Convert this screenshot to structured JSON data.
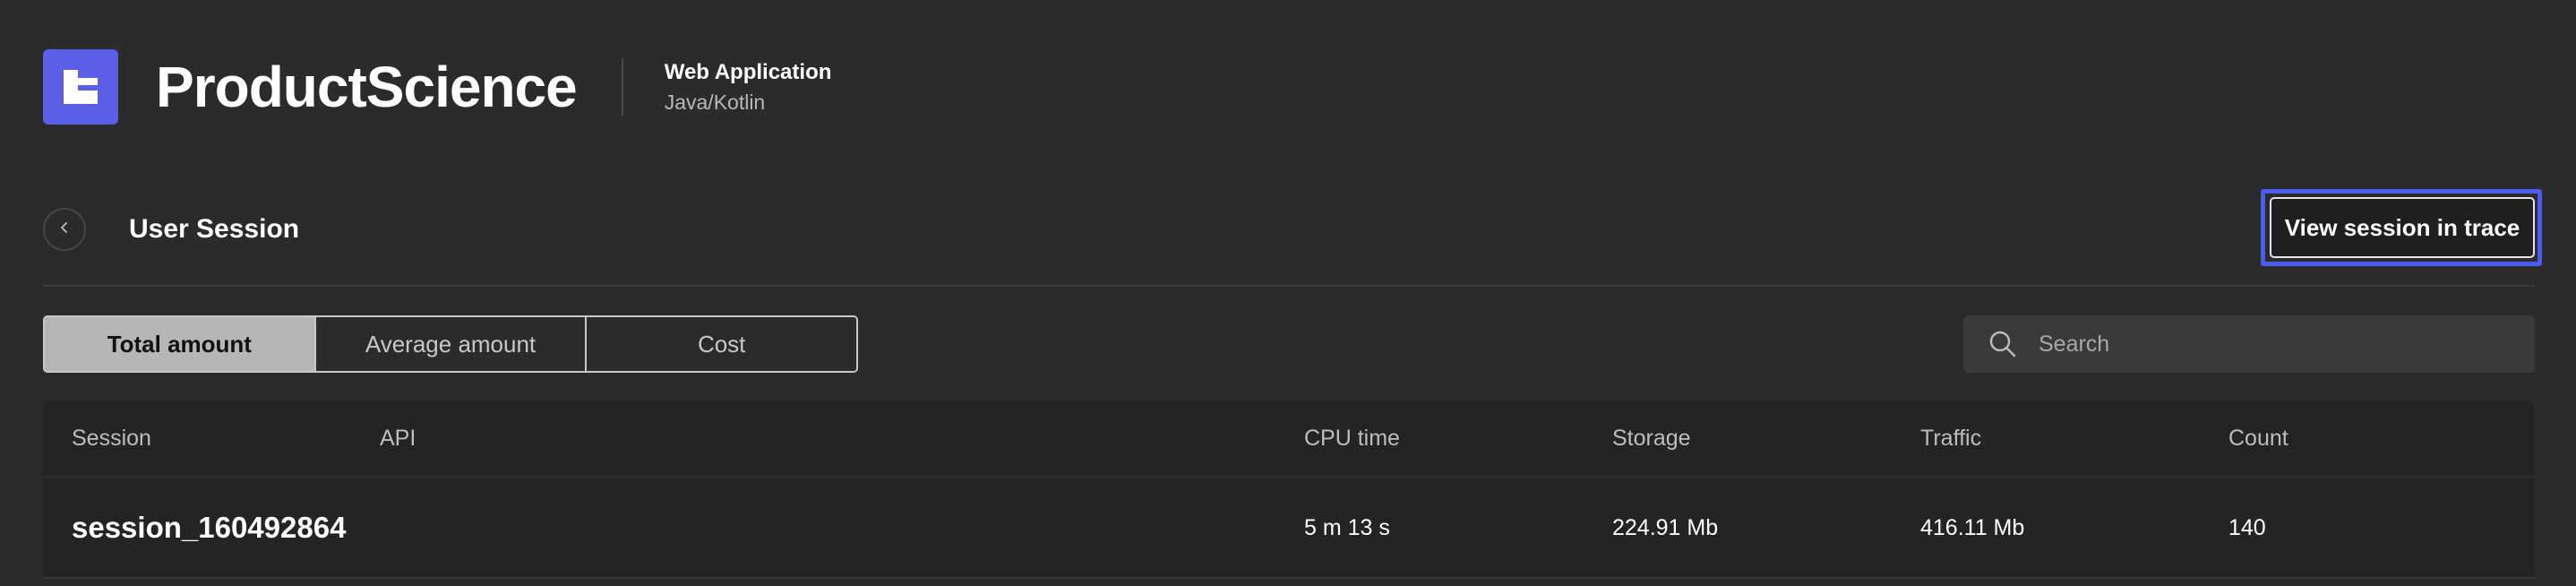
{
  "brand": {
    "name": "ProductScience",
    "app_type": "Web Application",
    "app_language": "Java/Kotlin",
    "accent_color": "#5b5fe8"
  },
  "session_bar": {
    "title": "User Session",
    "back_icon": "chevron-left-icon",
    "trace_button_label": "View session in trace"
  },
  "tabs": [
    {
      "label": "Total amount",
      "active": true
    },
    {
      "label": "Average amount",
      "active": false
    },
    {
      "label": "Cost",
      "active": false
    }
  ],
  "search": {
    "placeholder": "Search",
    "icon": "search-icon"
  },
  "table": {
    "columns": {
      "session": "Session",
      "api": "API",
      "cpu_time": "CPU time",
      "storage": "Storage",
      "traffic": "Traffic",
      "count": "Count"
    },
    "rows": [
      {
        "session": "session_160492864",
        "api": "",
        "cpu_time": "5 m 13 s",
        "storage": "224.91 Mb",
        "traffic": "416.11 Mb",
        "count": "140"
      }
    ]
  }
}
